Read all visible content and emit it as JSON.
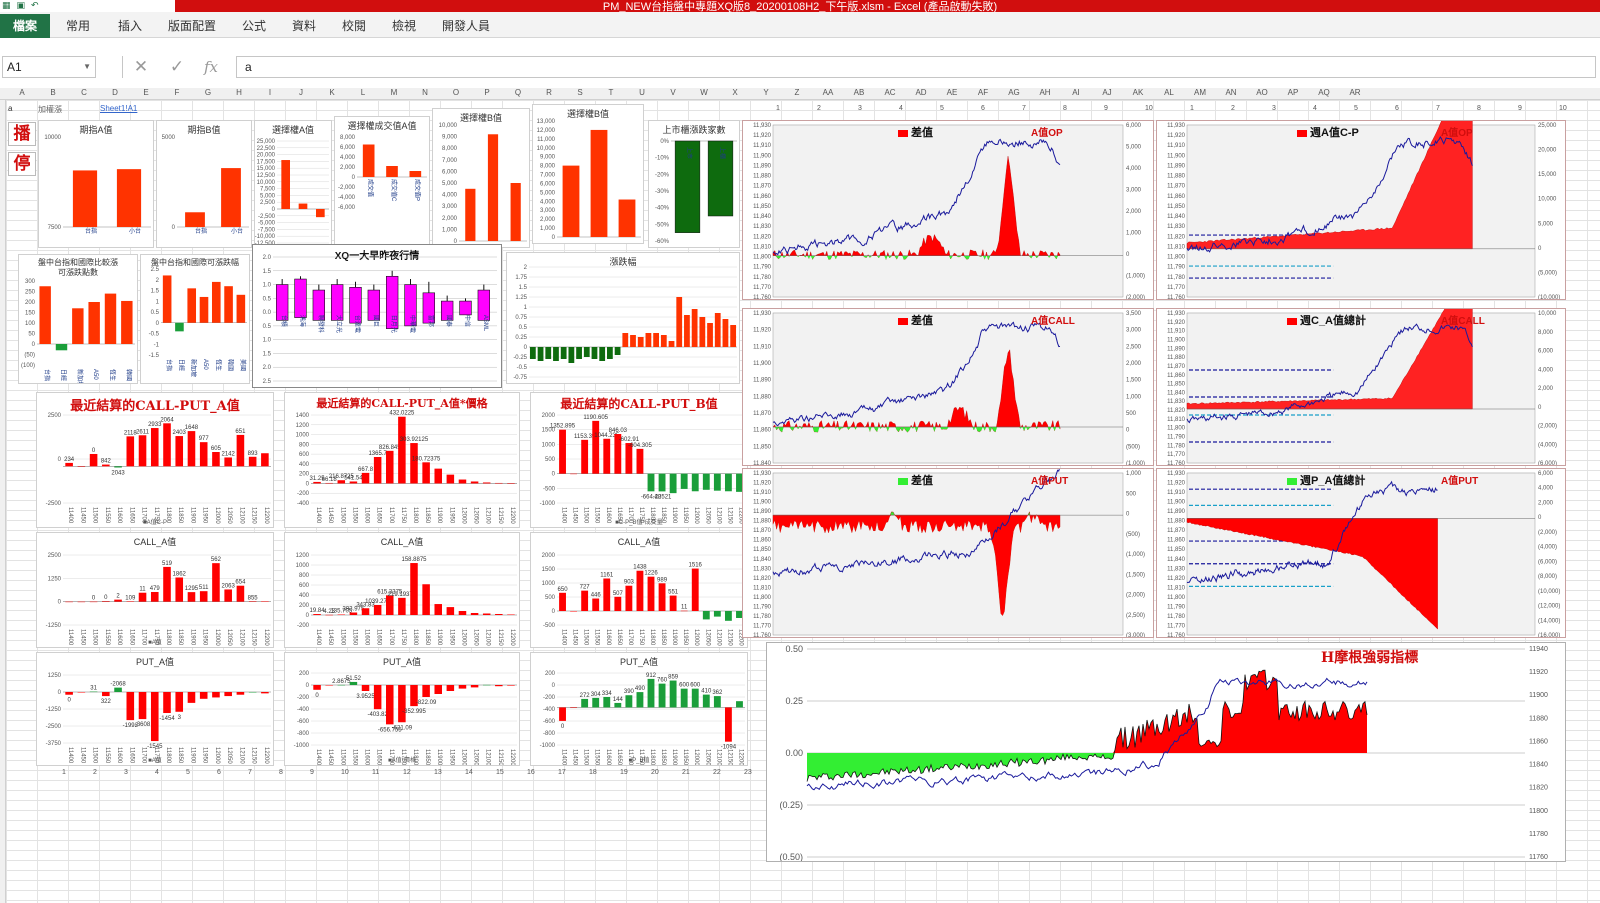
{
  "window": {
    "title": "PM_NEW台指盤中專題XQ版8_20200108H2_下午版.xlsm - Excel (產品啟動失敗)"
  },
  "ribbon": {
    "tabs": [
      "檔案",
      "常用",
      "插入",
      "版面配置",
      "公式",
      "資料",
      "校閱",
      "檢視",
      "開發人員"
    ]
  },
  "formula_bar": {
    "name_box": "A1",
    "cancel": "✕",
    "enter": "✓",
    "fx": "fx",
    "value": "a"
  },
  "sheet": {
    "columns": [
      "A",
      "B",
      "C",
      "D",
      "E",
      "F",
      "G",
      "H",
      "I",
      "J",
      "K",
      "L",
      "M",
      "N",
      "O",
      "P",
      "Q",
      "R",
      "S",
      "T",
      "U",
      "V",
      "W",
      "X",
      "Y",
      "Z",
      "AA",
      "AB",
      "AC",
      "AD",
      "AE",
      "AF",
      "AG",
      "AH",
      "AI",
      "AJ",
      "AK",
      "AL",
      "AM",
      "AN",
      "AO",
      "AP",
      "AQ",
      "AR"
    ],
    "cell_a": "a",
    "note": "加權漲",
    "link": "Sheet1!A1",
    "bottom_numbers": [
      "1",
      "2",
      "3",
      "4",
      "5",
      "6",
      "7",
      "8",
      "9",
      "10",
      "11",
      "12",
      "13",
      "14",
      "15",
      "16",
      "17",
      "18",
      "19",
      "20",
      "21",
      "22",
      "23"
    ],
    "ruler_left": [
      "1",
      "2",
      "3",
      "4",
      "5",
      "6",
      "7",
      "8",
      "9",
      "10"
    ],
    "ruler_right": [
      "1",
      "2",
      "3",
      "4",
      "5",
      "6",
      "7",
      "8",
      "9",
      "10"
    ]
  },
  "buttons": {
    "play": "播",
    "stop": "停"
  },
  "colors": {
    "red": "#ff0000",
    "orange": "#ff3300",
    "green": "#1a9e3a",
    "bright_green": "#33ee33",
    "magenta": "#ff00ff",
    "navy": "#1a1a9c",
    "dark_green": "#0e6b0e"
  },
  "panels": {
    "a_value": {
      "title": "期指A值",
      "ticks": [
        "10000",
        "7500"
      ],
      "cats": [
        "台指",
        "小台"
      ]
    },
    "b_value": {
      "title": "期指B值",
      "ticks": [
        "5000",
        "0"
      ],
      "cats": [
        "台指",
        "小台"
      ]
    },
    "opt_a": {
      "title": "選擇權A值",
      "ticks": [
        "25,000",
        "22,500",
        "20,000",
        "17,500",
        "15,000",
        "12,500",
        "10,000",
        "7,500",
        "5,000",
        "2,500",
        "0",
        "-2,500",
        "-5,000",
        "-7,500",
        "-10,000",
        "-12,500"
      ]
    },
    "opt_vol_a": {
      "title": "選擇權成交值A值",
      "ticks": [
        "8,000",
        "6,000",
        "4,000",
        "2,000",
        "0",
        "-2,000",
        "-4,000",
        "-6,000"
      ],
      "cats": [
        "成交值",
        "成交值C",
        "成交值P"
      ]
    },
    "opt_b": {
      "title": "選擇權B值",
      "ticks": [
        "10,000",
        "9,000",
        "8,000",
        "7,000",
        "6,000",
        "5,000",
        "4,000",
        "3,000",
        "2,000",
        "1,000",
        "0"
      ]
    },
    "opt_b2": {
      "title": "選擇權B值",
      "ticks": [
        "13,000",
        "12,000",
        "11,000",
        "10,000",
        "9,000",
        "8,000",
        "7,000",
        "6,000",
        "5,000",
        "4,000",
        "3,000",
        "2,000",
        "1,000",
        "0"
      ]
    },
    "listed": {
      "title": "上市櫃漲跌家數",
      "ticks": [
        "0%",
        "-10%",
        "-20%",
        "-30%",
        "-40%",
        "-50%",
        "-60%"
      ],
      "cats": [
        "上市",
        "上櫃"
      ]
    },
    "intl_rise": {
      "title": "盤中台指和國際比較漲",
      "subtitle": "可漲跌點數",
      "ticks": [
        "300",
        "250",
        "200",
        "150",
        "100",
        "50",
        "0",
        "(50)",
        "(100)"
      ],
      "cats": [
        "台指",
        "日經",
        "新加坡",
        "A50",
        "恆生",
        "韓國"
      ]
    },
    "intl_fall": {
      "title": "盤中台指和國際可漲跌幅",
      "ticks": [
        "2.5",
        "2",
        "1.5",
        "1",
        "0.5",
        "0",
        "-0.5",
        "-1",
        "-1.5"
      ],
      "cats": [
        "台指",
        "日經",
        "新加坡",
        "A50",
        "恆生",
        "韓國",
        "美國"
      ]
    },
    "xq_overnight": {
      "title": "XQ一大早昨夜行情",
      "ticks": [
        "2.0",
        "1.5",
        "1.0",
        "0.5",
        "0.0",
        "0.5",
        "1.0",
        "1.5",
        "2.0",
        "2.5"
      ],
      "cats": [
        "台積",
        "鴻海",
        "聯發科",
        "大立光",
        "台達電",
        "國巨",
        "日月光",
        "中華電",
        "富邦",
        "國泰",
        "中信",
        "ASML"
      ]
    },
    "change": {
      "title": "漲跌幅",
      "ticks": [
        "2",
        "1.75",
        "1.5",
        "1.25",
        "1",
        "0.75",
        "0.5",
        "0.25",
        "0",
        "-0.25",
        "-0.5",
        "-0.75"
      ]
    },
    "cp_a": {
      "title": "最近結算的CALL-PUT_A值",
      "ticks": [
        "2500",
        "0",
        "-2500"
      ],
      "labels": [
        "234",
        "0",
        "842",
        "2043",
        "2118",
        "2611",
        "2933",
        "2064",
        "2403",
        "1648",
        "977",
        "605",
        "2142",
        "651",
        "893"
      ],
      "cats": [
        "11400",
        "11450",
        "11500",
        "11550",
        "11600",
        "11650",
        "11700",
        "11750",
        "11800",
        "11850",
        "11900",
        "11950",
        "12000",
        "12050",
        "12100",
        "12150",
        "12200"
      ],
      "legend": "■A值C-P"
    },
    "cp_a_price": {
      "title": "最近結算的CALL-PUT_A值*價格",
      "ticks": [
        "1400",
        "1200",
        "1000",
        "800",
        "600",
        "400",
        "200",
        "0",
        "-200",
        "-400"
      ],
      "labels": [
        "31.25",
        "66.18",
        "216.8725",
        "541.54",
        "667.8",
        "1365.7",
        "826.845",
        "432.0225",
        "303.92125",
        "180.72375"
      ],
      "cats": [
        "11400",
        "11450",
        "11500",
        "11550",
        "11600",
        "11650",
        "11700",
        "11750",
        "11800",
        "11850",
        "11900",
        "11950",
        "12000",
        "12050",
        "12100",
        "12150",
        "12200"
      ]
    },
    "cp_b": {
      "title": "最近結算的CALL-PUT_B值",
      "ticks": [
        "2000",
        "1500",
        "1000",
        "500",
        "0",
        "-500",
        "-1000"
      ],
      "labels": [
        "1352.895",
        "1153.39",
        "1190.605",
        "1044.235",
        "846.03",
        "-602.91",
        "-604.305",
        "-664.42",
        "-20521"
      ],
      "cats": [
        "11400",
        "11450",
        "11500",
        "11550",
        "11600",
        "11650",
        "11700",
        "11750",
        "11800",
        "11850",
        "11900",
        "11950",
        "12000",
        "12050",
        "12100",
        "12150",
        "12200"
      ],
      "legend": "■C-P_B值*成交量"
    },
    "call_a": {
      "title": "CALL_A值",
      "ticks": [
        "2500",
        "1250",
        "0",
        "-1250"
      ],
      "labels": [
        "0",
        "0",
        "2",
        "109",
        "11",
        "479",
        "519",
        "1862",
        "1295",
        "511",
        "562",
        "2063",
        "654",
        "855"
      ],
      "cats": [
        "11400",
        "11450",
        "11500",
        "11550",
        "11600",
        "11650",
        "11700",
        "11750",
        "11800",
        "11850",
        "11900",
        "11950",
        "12000",
        "12050",
        "12100",
        "12150",
        "12200"
      ],
      "legend": "■A值"
    },
    "call_a_price": {
      "title": "CALL_A值",
      "ticks": [
        "1200",
        "1000",
        "800",
        "600",
        "400",
        "200",
        "0",
        "-200"
      ],
      "labels": [
        "19.84",
        "4.23",
        "135.705",
        "393.975",
        "343.83",
        "1039.275",
        "615.3375",
        "219.19375",
        "158.8875"
      ],
      "cats": [
        "11400",
        "11450",
        "11500",
        "11550",
        "11600",
        "11650",
        "11700",
        "11750",
        "11800",
        "11850",
        "11900",
        "11950",
        "12000",
        "12050",
        "12100",
        "12150",
        "12200"
      ]
    },
    "call_b": {
      "title": "CALL_A值",
      "ticks": [
        "2000",
        "1500",
        "1000",
        "500",
        "0",
        "-500"
      ],
      "labels": [
        "650",
        "727",
        "446",
        "1161",
        "507",
        "903",
        "1438",
        "1226",
        "989",
        "551",
        "11",
        "1516"
      ],
      "cats": [
        "11400",
        "11450",
        "11500",
        "11550",
        "11600",
        "11650",
        "11700",
        "11750",
        "11800",
        "11850",
        "11900",
        "11950",
        "12000",
        "12050",
        "12100",
        "12150",
        "12200"
      ]
    },
    "put_a": {
      "title": "PUT_A值",
      "ticks": [
        "1250",
        "0",
        "-1250",
        "-2500",
        "-3750"
      ],
      "labels": [
        "0",
        "31",
        "322",
        "-2068",
        "-1992",
        "-3608",
        "-1545",
        "-1454",
        "3"
      ],
      "cats": [
        "11400",
        "11450",
        "11500",
        "11550",
        "11600",
        "11650",
        "11700",
        "11750",
        "11800",
        "11850",
        "11900",
        "11950",
        "12000",
        "12050",
        "12100",
        "12150",
        "12200"
      ],
      "legend": "■A值"
    },
    "put_a_price": {
      "title": "PUT_A值",
      "ticks": [
        "200",
        "0",
        "-200",
        "-400",
        "-600",
        "-800",
        "-1000"
      ],
      "labels": [
        "0",
        "2.8675",
        "51.52",
        "3.9525",
        "-403.82",
        "-656.755",
        "-621.09",
        "-352.995",
        "-822.09"
      ],
      "cats": [
        "11400",
        "11450",
        "11500",
        "11550",
        "11600",
        "11650",
        "11700",
        "11750",
        "11800",
        "11850",
        "11900",
        "11950",
        "12000",
        "12050",
        "12100",
        "12150",
        "12200"
      ],
      "legend": "■A值*價格"
    },
    "put_b": {
      "title": "PUT_A值",
      "ticks": [
        "200",
        "0",
        "-200",
        "-400",
        "-600",
        "-800",
        "-1000"
      ],
      "labels": [
        "0",
        "272",
        "304",
        "334",
        "144",
        "390",
        "490",
        "912",
        "760",
        "859",
        "600",
        "600",
        "410",
        "362",
        "-1094"
      ],
      "cats": [
        "11400",
        "11450",
        "11500",
        "11550",
        "11600",
        "11650",
        "11700",
        "11750",
        "11800",
        "11850",
        "11900",
        "11950",
        "12000",
        "12050",
        "12100",
        "12150",
        "12200"
      ],
      "legend": "■P_B值"
    }
  },
  "intraday": {
    "op": {
      "series": "差值",
      "tag": "A值OP",
      "left_ticks": [
        "11,930",
        "11,920",
        "11,910",
        "11,900",
        "11,890",
        "11,880",
        "11,870",
        "11,860",
        "11,850",
        "11,840",
        "11,830",
        "11,820",
        "11,810",
        "11,800",
        "11,790",
        "11,780",
        "11,770",
        "11,760"
      ],
      "right_ticks": [
        "6,000",
        "5,000",
        "4,000",
        "3,000",
        "2,000",
        "1,000",
        "0",
        "(1,000)",
        "(2,000)"
      ]
    },
    "op_cum": {
      "series": "週A值C-P",
      "tag": "A值OP",
      "left_ticks": [
        "11,930",
        "11,920",
        "11,910",
        "11,900",
        "11,890",
        "11,880",
        "11,870",
        "11,860",
        "11,850",
        "11,840",
        "11,830",
        "11,820",
        "11,810",
        "11,800",
        "11,790",
        "11,780",
        "11,770",
        "11,760"
      ],
      "right_ticks": [
        "25,000",
        "20,000",
        "15,000",
        "10,000",
        "5,000",
        "0",
        "(5,000)",
        "(10,000)"
      ]
    },
    "call": {
      "series": "差值",
      "tag": "A值CALL",
      "left_ticks": [
        "11,930",
        "11,920",
        "11,910",
        "11,900",
        "11,890",
        "11,880",
        "11,870",
        "11,860",
        "11,850",
        "11,840"
      ],
      "right_ticks": [
        "3,500",
        "3,000",
        "2,500",
        "2,000",
        "1,500",
        "1,000",
        "500",
        "0",
        "(500)",
        "(1,000)"
      ]
    },
    "call_cum": {
      "series": "週C_A值總計",
      "tag": "A值CALL",
      "left_ticks": [
        "11,930",
        "11,920",
        "11,910",
        "11,900",
        "11,890",
        "11,880",
        "11,870",
        "11,860",
        "11,850",
        "11,840",
        "11,830",
        "11,820",
        "11,810",
        "11,800",
        "11,790",
        "11,780",
        "11,770",
        "11,760"
      ],
      "right_ticks": [
        "10,000",
        "8,000",
        "6,000",
        "4,000",
        "2,000",
        "0",
        "(2,000)",
        "(4,000)",
        "(6,000)"
      ]
    },
    "put": {
      "series": "差值",
      "tag": "A值PUT",
      "left_ticks": [
        "11,930",
        "11,920",
        "11,910",
        "11,900",
        "11,890",
        "11,880",
        "11,870",
        "11,860",
        "11,850",
        "11,840",
        "11,830",
        "11,820",
        "11,810",
        "11,800",
        "11,790",
        "11,780",
        "11,770",
        "11,760"
      ],
      "right_ticks": [
        "1,000",
        "500",
        "0",
        "(500)",
        "(1,000)",
        "(1,500)",
        "(2,000)",
        "(2,500)",
        "(3,000)"
      ]
    },
    "put_cum": {
      "series": "週P_A值總計",
      "tag": "A值PUT",
      "left_ticks": [
        "11,930",
        "11,920",
        "11,910",
        "11,900",
        "11,890",
        "11,880",
        "11,870",
        "11,860",
        "11,850",
        "11,840",
        "11,830",
        "11,820",
        "11,810",
        "11,800",
        "11,790",
        "11,780",
        "11,770",
        "11,760"
      ],
      "right_ticks": [
        "6,000",
        "4,000",
        "2,000",
        "0",
        "(2,000)",
        "(4,000)",
        "(6,000)",
        "(8,000)",
        "(10,000)",
        "(12,000)",
        "(14,000)",
        "(16,000)"
      ]
    },
    "morgan": {
      "tag": "H摩根強弱指標",
      "left_ticks": [
        "0.50",
        "0.25",
        "0.00",
        "(0.25)",
        "(0.50)"
      ],
      "right_ticks": [
        "11940",
        "11920",
        "11900",
        "11880",
        "11860",
        "11840",
        "11820",
        "11800",
        "11780",
        "11760"
      ]
    }
  }
}
